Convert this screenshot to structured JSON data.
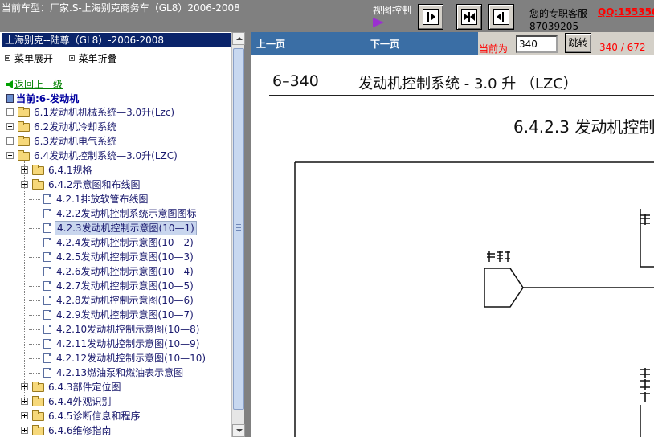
{
  "header": {
    "vehicle_info": "当前车型：厂家.S-上海别克商务车（GL8）2006-2008",
    "view_control_label": "视图控制",
    "service_label": "您的专职客服",
    "service_qq": "QQ:1553501",
    "service_phone": "87039205"
  },
  "view_buttons": [
    {
      "name": "prev-view",
      "icon": "step-right-icon"
    },
    {
      "name": "fit-view",
      "icon": "collapse-center-icon"
    },
    {
      "name": "next-view",
      "icon": "step-left-icon"
    }
  ],
  "sidebar": {
    "title": "上海别克--陆尊（GL8）-2006-2008",
    "expand_all": "菜单展开",
    "collapse_all": "菜单折叠",
    "back_link": "返回上一级",
    "current_section": "当前:6-发动机",
    "tree": [
      {
        "label": "6.1发动机机械系统—3.0升(Lzc)",
        "level": 0,
        "kind": "folder",
        "toggle": "plus"
      },
      {
        "label": "6.2发动机冷却系统",
        "level": 0,
        "kind": "folder",
        "toggle": "plus"
      },
      {
        "label": "6.3发动机电气系统",
        "level": 0,
        "kind": "folder",
        "toggle": "plus"
      },
      {
        "label": "6.4发动机控制系统—3.0升(LZC)",
        "level": 0,
        "kind": "folder",
        "toggle": "minus"
      },
      {
        "label": "6.4.1规格",
        "level": 1,
        "kind": "folder",
        "toggle": "plus"
      },
      {
        "label": "6.4.2示意图和布线图",
        "level": 1,
        "kind": "folder",
        "toggle": "minus"
      },
      {
        "label": "4.2.1排放软管布线图",
        "level": 2,
        "kind": "doc"
      },
      {
        "label": "4.2.2发动机控制系统示意图图标",
        "level": 2,
        "kind": "doc"
      },
      {
        "label": "4.2.3发动机控制示意图(10—1)",
        "level": 2,
        "kind": "doc",
        "selected": true
      },
      {
        "label": "4.2.4发动机控制示意图(10—2)",
        "level": 2,
        "kind": "doc"
      },
      {
        "label": "4.2.5发动机控制示意图(10—3)",
        "level": 2,
        "kind": "doc"
      },
      {
        "label": "4.2.6发动机控制示意图(10—4)",
        "level": 2,
        "kind": "doc"
      },
      {
        "label": "4.2.7发动机控制示意图(10—5)",
        "level": 2,
        "kind": "doc"
      },
      {
        "label": "4.2.8发动机控制示意图(10—6)",
        "level": 2,
        "kind": "doc"
      },
      {
        "label": "4.2.9发动机控制示意图(10—7)",
        "level": 2,
        "kind": "doc"
      },
      {
        "label": "4.2.10发动机控制示意图(10—8)",
        "level": 2,
        "kind": "doc"
      },
      {
        "label": "4.2.11发动机控制示意图(10—9)",
        "level": 2,
        "kind": "doc"
      },
      {
        "label": "4.2.12发动机控制示意图(10—10)",
        "level": 2,
        "kind": "doc"
      },
      {
        "label": "4.2.13燃油泵和燃油表示意图",
        "level": 2,
        "kind": "doc"
      },
      {
        "label": "6.4.3部件定位图",
        "level": 1,
        "kind": "folder",
        "toggle": "plus"
      },
      {
        "label": "6.4.4外观识别",
        "level": 1,
        "kind": "folder",
        "toggle": "plus"
      },
      {
        "label": "6.4.5诊断信息和程序",
        "level": 1,
        "kind": "folder",
        "toggle": "plus"
      },
      {
        "label": "6.4.6维修指南",
        "level": 1,
        "kind": "folder",
        "toggle": "plus"
      }
    ]
  },
  "pager": {
    "prev_label": "上一页",
    "next_label": "下一页",
    "current_label": "当前为",
    "page_value": "340",
    "jump_label": "跳转",
    "page_count": "340 / 672"
  },
  "document": {
    "page_no": "6–340",
    "title": "发动机控制系统 - 3.0 升 （LZC）",
    "subtitle": "6.4.2.3 发动机控制"
  },
  "colors": {
    "chrome": "#808080",
    "nav_blue": "#3a6ea5",
    "tree_title": "#0a246a",
    "alert_red": "#ff0000"
  }
}
